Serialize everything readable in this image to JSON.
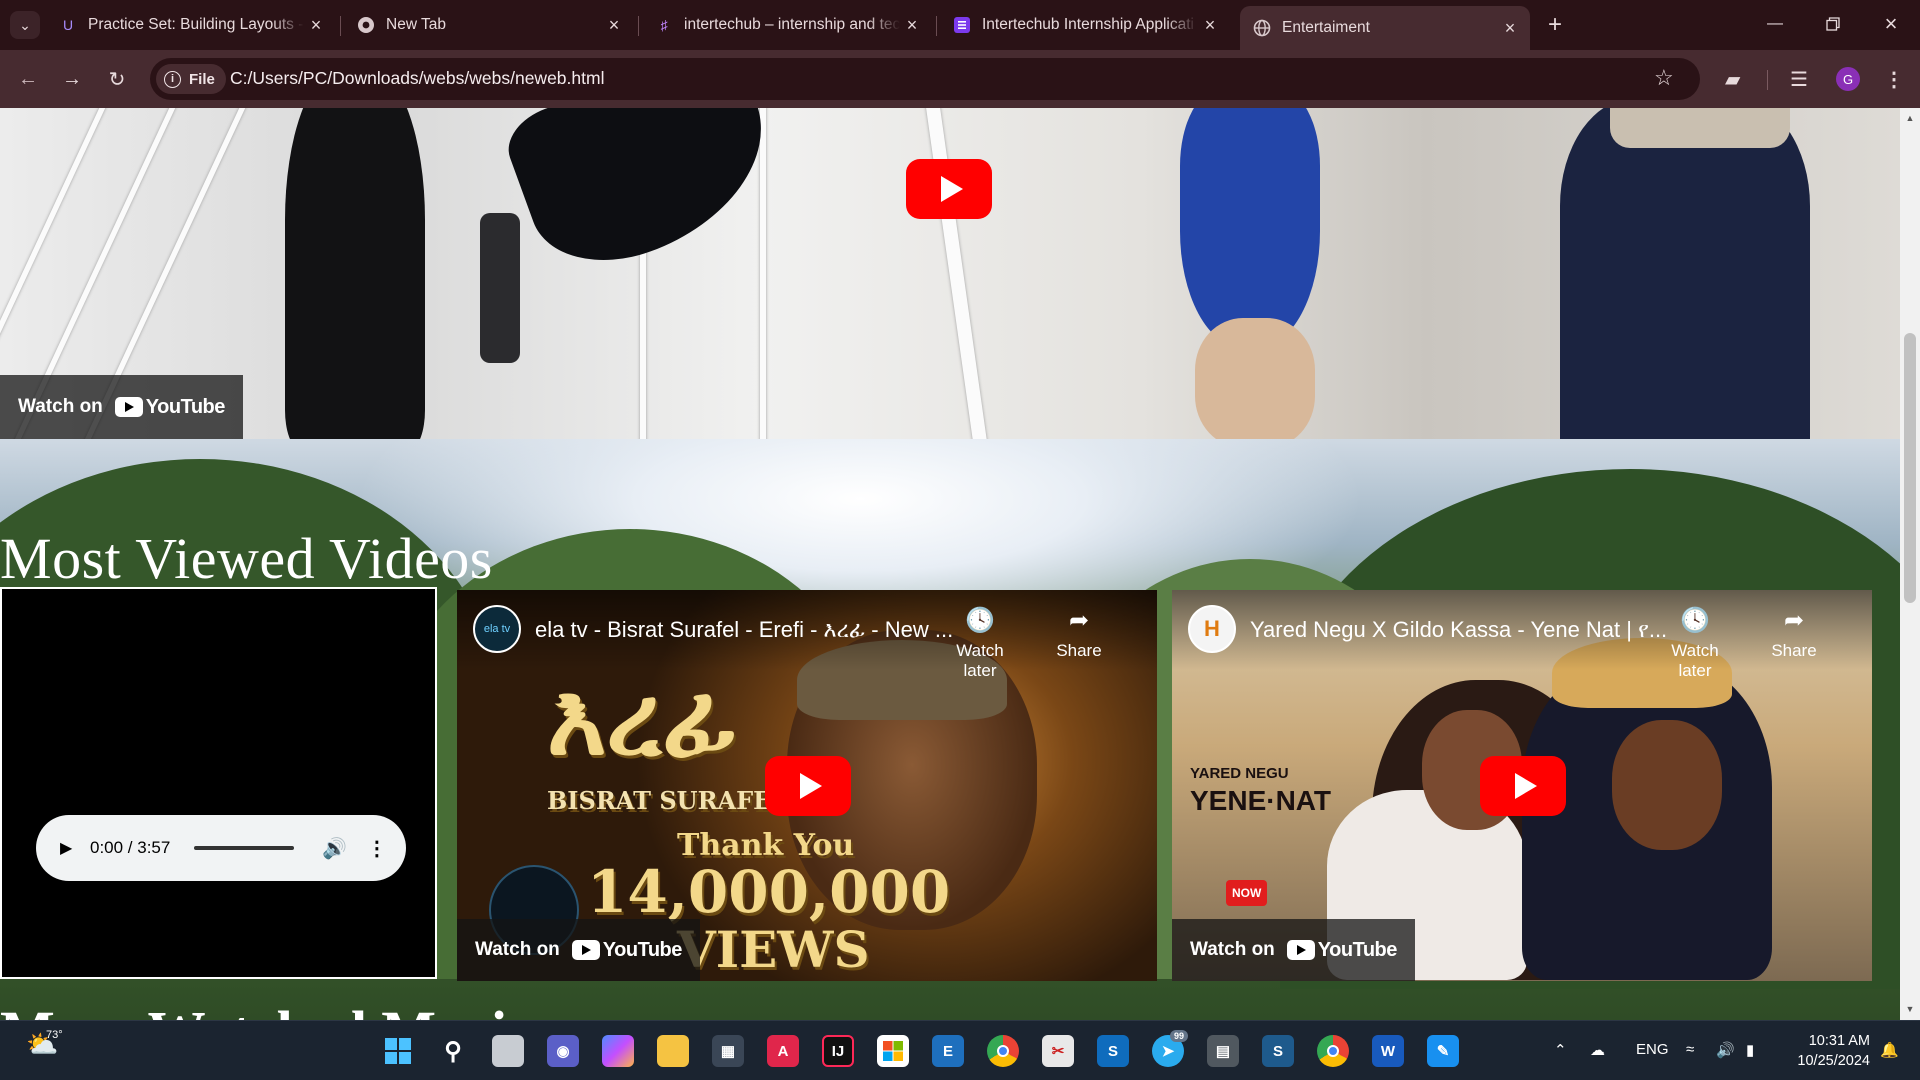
{
  "browser": {
    "tabs": [
      {
        "title": "Practice Set: Building Layouts -",
        "icon": "udemy-icon",
        "active": false
      },
      {
        "title": "New Tab",
        "icon": "chrome-icon",
        "active": false
      },
      {
        "title": "intertechub – internship and tec",
        "icon": "intertechub-icon",
        "active": false
      },
      {
        "title": "Intertechub Internship Applicati",
        "icon": "forms-icon",
        "active": false
      },
      {
        "title": "Entertaiment",
        "icon": "globe-icon",
        "active": true
      }
    ],
    "chip_label": "File",
    "url": "C:/Users/PC/Downloads/webs/webs/neweb.html",
    "profile_initial": "G"
  },
  "page": {
    "top_video": {
      "watch_on": "Watch on",
      "youtube": "YouTube"
    },
    "section_title": "Most Viewed Videos",
    "next_section_title": "More Watched Music",
    "audio": {
      "time": "0:00 / 3:57"
    },
    "videos": [
      {
        "title": "ela tv - Bisrat Surafel - Erefi - እረፊ - New ...",
        "channel_badge": "ela tv",
        "watch_later": "Watch later",
        "share": "Share",
        "watch_on": "Watch on",
        "youtube": "YouTube",
        "art_title": "እረፊ",
        "art_artist": "BISRAT SURAFEL",
        "art_thanks": "Thank You",
        "art_count": "14,000,000",
        "art_views": "VIEWS"
      },
      {
        "title": "Yared Negu X Gildo Kassa - Yene Nat | የ...",
        "channel_badge": "H",
        "watch_later": "Watch later",
        "share": "Share",
        "watch_on": "Watch on",
        "youtube": "YouTube",
        "art_artist": "YARED NEGU",
        "art_song": "YENE·NAT",
        "art_subscribe": "NOW"
      }
    ]
  },
  "taskbar": {
    "weather": "73°",
    "language": "ENG",
    "time": "10:31 AM",
    "date": "10/25/2024",
    "telegram_badge": "99",
    "apps": [
      "windows-start",
      "search",
      "task-view",
      "teams",
      "copilot",
      "file-explorer",
      "calculator",
      "autocad",
      "intellij",
      "store",
      "excel-alt",
      "chrome",
      "snipping",
      "sharepoint",
      "telegram",
      "archive",
      "sway",
      "chrome-profile",
      "word",
      "paint"
    ]
  },
  "colors": {
    "accent_tab": "#472b30",
    "tabstrip": "#2a1216",
    "youtube_red": "#ff0000"
  }
}
